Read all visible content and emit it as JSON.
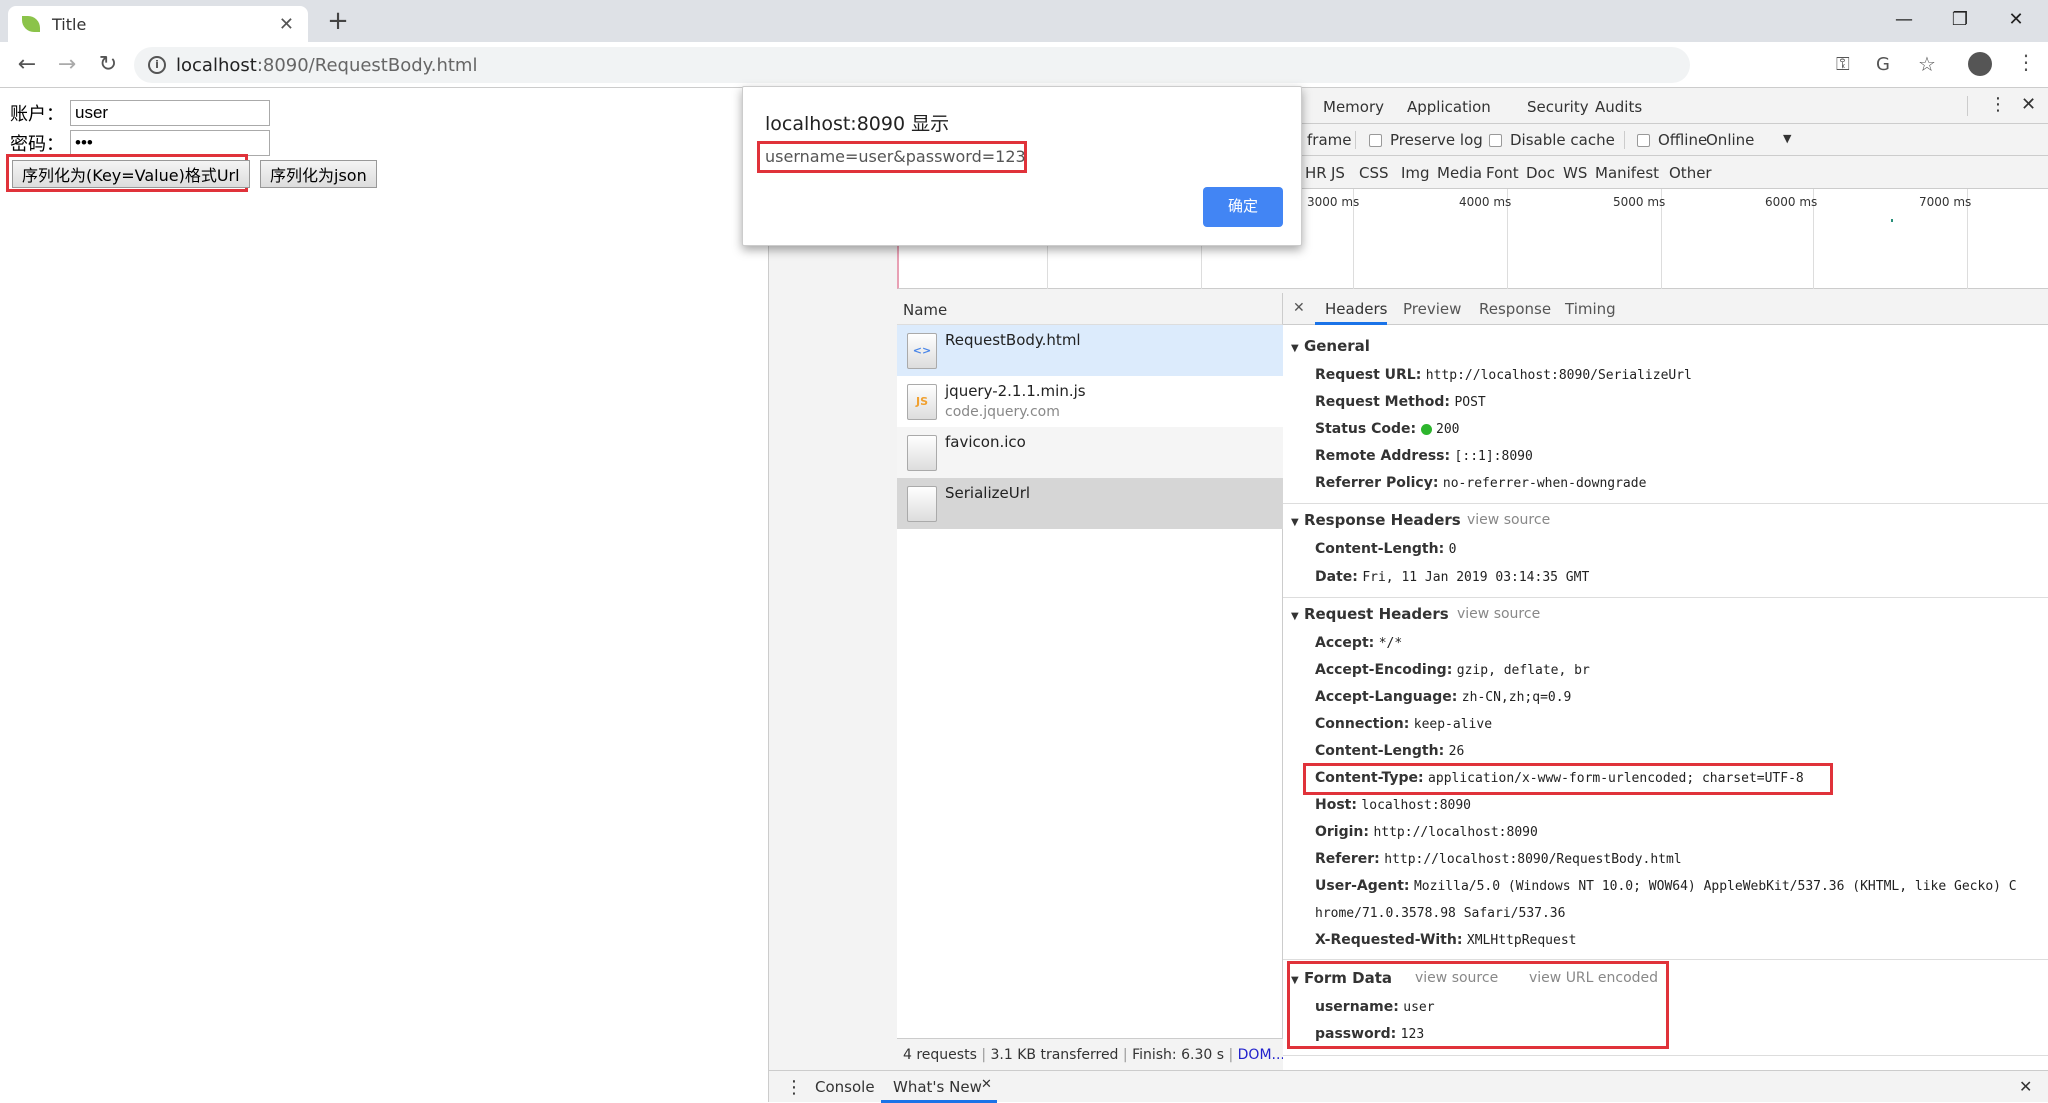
{
  "browser": {
    "tab_title": "Title",
    "url_host": "localhost",
    "url_rest": ":8090/RequestBody.html"
  },
  "page": {
    "account_label": "账户：",
    "account_value": "user",
    "password_label": "密码：",
    "password_value": "•••",
    "btn_serialize_url": "序列化为(Key=Value)格式Url",
    "btn_serialize_json": "序列化为json"
  },
  "dialog": {
    "title": "localhost:8090 显示",
    "message": "username=user&password=123",
    "ok_label": "确定"
  },
  "devtools": {
    "tabs": [
      "Memory",
      "Application",
      "Security",
      "Audits"
    ],
    "toolbar": {
      "frame_label": "frame",
      "preserve_log": "Preserve log",
      "disable_cache": "Disable cache",
      "offline": "Offline",
      "throttle": "Online"
    },
    "filters": [
      "HR",
      "JS",
      "CSS",
      "Img",
      "Media",
      "Font",
      "Doc",
      "WS",
      "Manifest",
      "Other"
    ],
    "timeline_ticks": [
      "3000 ms",
      "4000 ms",
      "5000 ms",
      "6000 ms",
      "7000 ms"
    ],
    "name_header": "Name",
    "requests": [
      {
        "name": "RequestBody.html",
        "sub": "",
        "icon": "html-file-icon"
      },
      {
        "name": "jquery-2.1.1.min.js",
        "sub": "code.jquery.com",
        "icon": "js-file-icon"
      },
      {
        "name": "favicon.ico",
        "sub": "",
        "icon": "blank-file-icon"
      },
      {
        "name": "SerializeUrl",
        "sub": "",
        "icon": "blank-file-icon"
      }
    ],
    "status": {
      "requests": "4 requests",
      "transferred": "3.1 KB transferred",
      "finish": "Finish: 6.30 s",
      "dom": "DOM..."
    },
    "detail_tabs": [
      "Headers",
      "Preview",
      "Response",
      "Timing"
    ],
    "general": {
      "title": "General",
      "rows": [
        {
          "k": "Request URL:",
          "v": "http://localhost:8090/SerializeUrl"
        },
        {
          "k": "Request Method:",
          "v": "POST"
        },
        {
          "k": "Status Code:",
          "v": "200"
        },
        {
          "k": "Remote Address:",
          "v": "[::1]:8090"
        },
        {
          "k": "Referrer Policy:",
          "v": "no-referrer-when-downgrade"
        }
      ]
    },
    "response_headers": {
      "title": "Response Headers",
      "view_source": "view source",
      "rows": [
        {
          "k": "Content-Length:",
          "v": "0"
        },
        {
          "k": "Date:",
          "v": "Fri, 11 Jan 2019 03:14:35 GMT"
        }
      ]
    },
    "request_headers": {
      "title": "Request Headers",
      "view_source": "view source",
      "rows": [
        {
          "k": "Accept:",
          "v": "*/*"
        },
        {
          "k": "Accept-Encoding:",
          "v": "gzip, deflate, br"
        },
        {
          "k": "Accept-Language:",
          "v": "zh-CN,zh;q=0.9"
        },
        {
          "k": "Connection:",
          "v": "keep-alive"
        },
        {
          "k": "Content-Length:",
          "v": "26"
        },
        {
          "k": "Content-Type:",
          "v": "application/x-www-form-urlencoded; charset=UTF-8"
        },
        {
          "k": "Host:",
          "v": "localhost:8090"
        },
        {
          "k": "Origin:",
          "v": "http://localhost:8090"
        },
        {
          "k": "Referer:",
          "v": "http://localhost:8090/RequestBody.html"
        },
        {
          "k": "User-Agent:",
          "v": "Mozilla/5.0 (Windows NT 10.0; WOW64) AppleWebKit/537.36 (KHTML, like Gecko) C"
        },
        {
          "k": "",
          "v": "hrome/71.0.3578.98 Safari/537.36"
        },
        {
          "k": "X-Requested-With:",
          "v": "XMLHttpRequest"
        }
      ]
    },
    "form_data": {
      "title": "Form Data",
      "view_source": "view source",
      "view_url_encoded": "view URL encoded",
      "rows": [
        {
          "k": "username:",
          "v": "user"
        },
        {
          "k": "password:",
          "v": "123"
        }
      ]
    },
    "drawer": {
      "console": "Console",
      "whats_new": "What's New"
    },
    "colors": {
      "accent": "#4285f4",
      "highlight": "#e0323a",
      "status_ok": "#2db52d",
      "selected_row": "#dcebfc"
    }
  }
}
